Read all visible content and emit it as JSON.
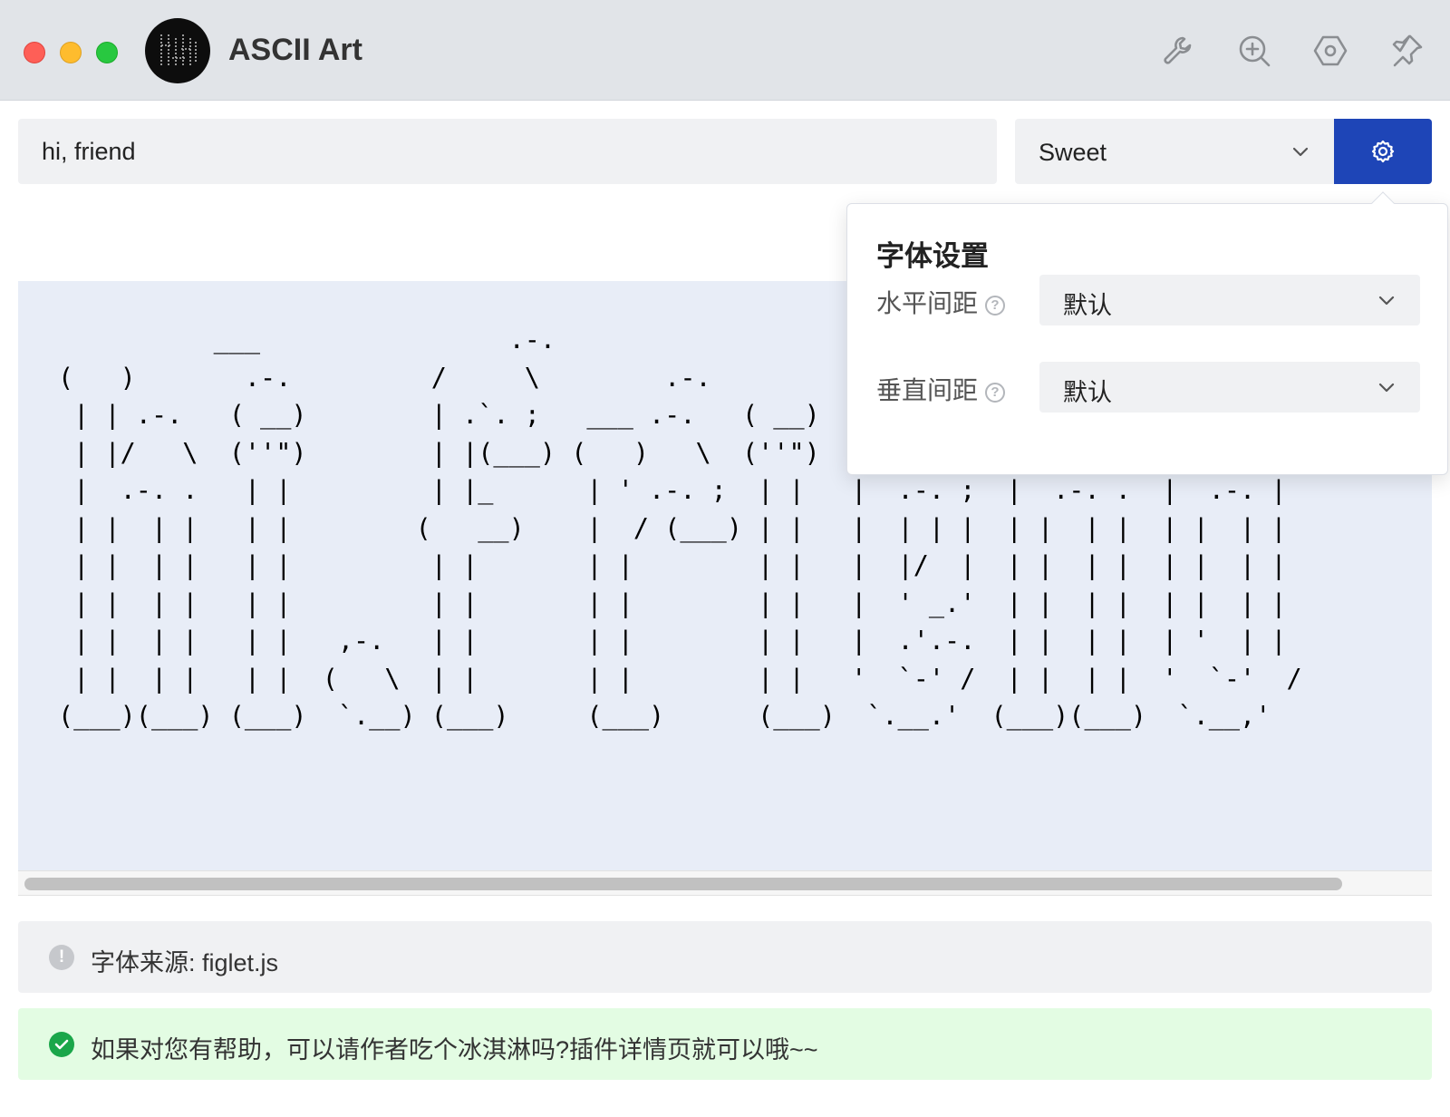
{
  "window": {
    "title": "ASCII Art",
    "traffic_lights": [
      "#fe5f57",
      "#febc2e",
      "#28c840"
    ]
  },
  "toolbar": {
    "icons": [
      "wrench-icon",
      "zoom-in-icon",
      "hexagon-icon",
      "pin-icon"
    ]
  },
  "input": {
    "value": "hi, friend"
  },
  "font_select": {
    "value": "Sweet"
  },
  "settings_button": {
    "icon": "gear-icon",
    "color": "#1e45b7"
  },
  "ascii_art": {
    "lines": [
      "          ___                .-.",
      "(   )       .-.         /     \\        .-.",
      " | | .-.   ( __)        | .`. ;   ___ .-.   ( __)",
      " | |/   \\  (''\")        | |(___) (   )   \\  (''\")",
      " |  .-. .   | |         | |_      | ' .-. ;  | |   |  .-. ;  |  .-. .  |  .-. |",
      " | |  | |   | |        (   __)    |  / (___) | |   |  | | |  | |  | |  | |  | |",
      " | |  | |   | |         | |       | |        | |   |  |/  |  | |  | |  | |  | |",
      " | |  | |   | |         | |       | |        | |   |  ' _.'  | |  | |  | |  | |",
      " | |  | |   | |   ,-.   | |       | |        | |   |  .'.-.  | |  | |  | '  | |",
      " | |  | |   | |  (   \\  | |       | |        | |   '  `-' /  | |  | |  '  `-'  /",
      "(___)(___) (___)  `.__) (___)     (___)      (___)  `.__.'  (___)(___)  `.__,'"
    ]
  },
  "popover": {
    "title": "字体设置",
    "horizontal_label": "水平间距",
    "horizontal_value": "默认",
    "vertical_label": "垂直间距",
    "vertical_value": "默认"
  },
  "info": {
    "text": "字体来源: figlet.js"
  },
  "success": {
    "text": "如果对您有帮助，可以请作者吃个冰淇淋吗?插件详情页就可以哦~~"
  }
}
